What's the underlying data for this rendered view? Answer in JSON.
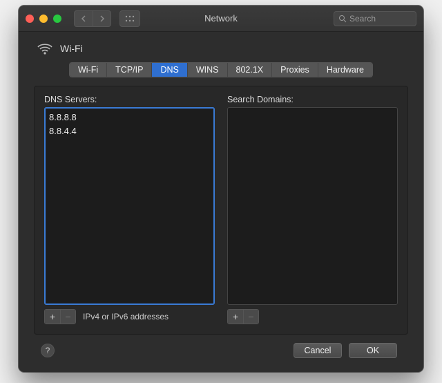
{
  "window": {
    "title": "Network",
    "search_placeholder": "Search"
  },
  "header": {
    "interface": "Wi-Fi"
  },
  "tabs": [
    {
      "label": "Wi-Fi",
      "active": false
    },
    {
      "label": "TCP/IP",
      "active": false
    },
    {
      "label": "DNS",
      "active": true
    },
    {
      "label": "WINS",
      "active": false
    },
    {
      "label": "802.1X",
      "active": false
    },
    {
      "label": "Proxies",
      "active": false
    },
    {
      "label": "Hardware",
      "active": false
    }
  ],
  "dns": {
    "label": "DNS Servers:",
    "servers": [
      "8.8.8.8",
      "8.8.4.4"
    ],
    "hint": "IPv4 or IPv6 addresses"
  },
  "search_domains": {
    "label": "Search Domains:",
    "domains": []
  },
  "buttons": {
    "cancel": "Cancel",
    "ok": "OK",
    "help": "?"
  }
}
